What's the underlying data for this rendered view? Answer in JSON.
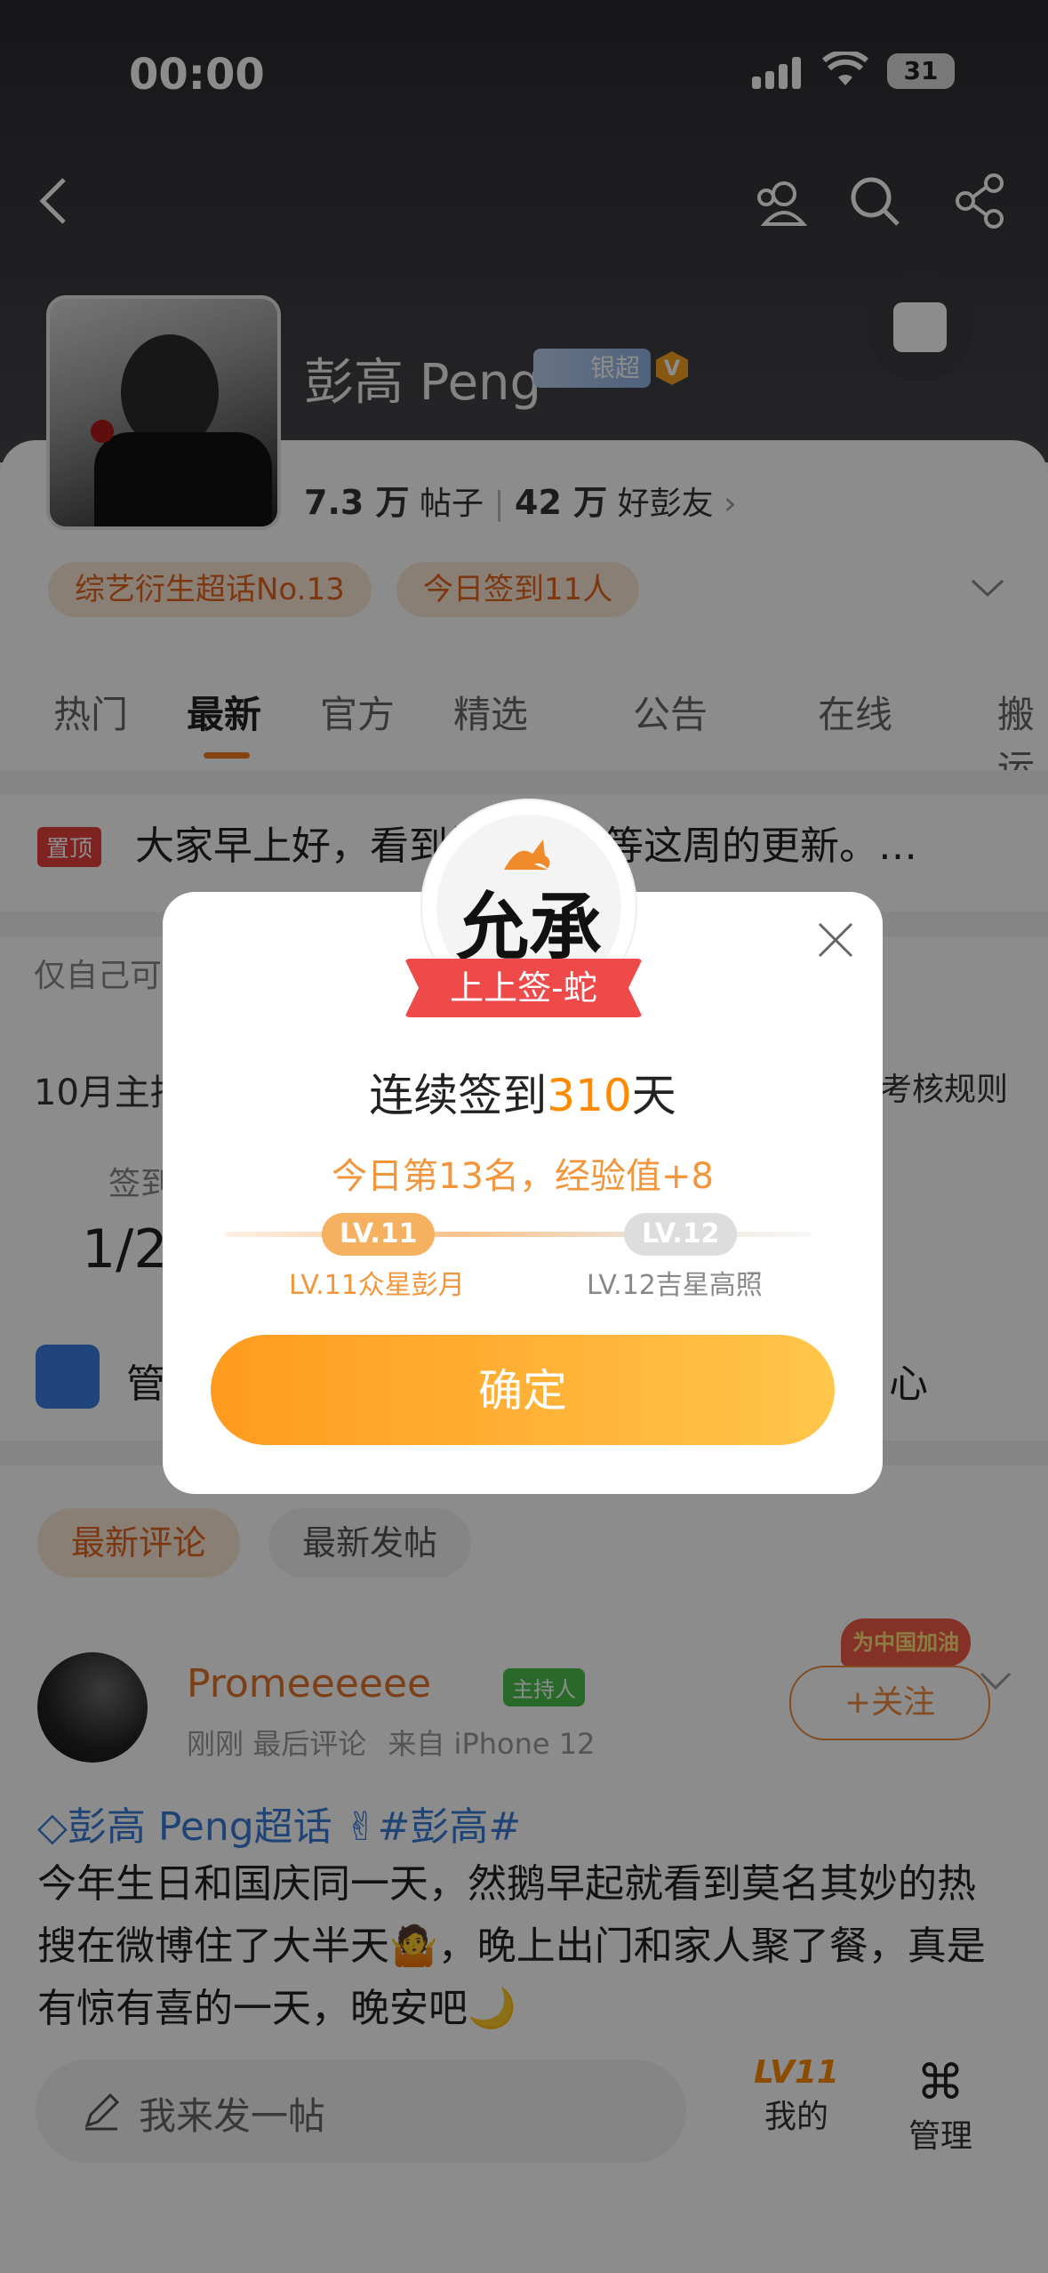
{
  "status_bar": {
    "time": "00:00",
    "battery": "31"
  },
  "profile": {
    "name": "彭高 Peng",
    "badge_level": "银超",
    "verified_mark": "V",
    "posts_count": "7.3 万",
    "posts_label": "帖子",
    "fans_count": "42 万",
    "fans_label": "好彭友",
    "fans_chevron": "›"
  },
  "chips": {
    "rank": "综艺衍生超话No.13",
    "checkin": "今日签到11人"
  },
  "tabs": [
    "热门",
    "最新",
    "官方",
    "精选",
    "公告",
    "在线",
    "搬运"
  ],
  "pinned": {
    "tag": "置顶",
    "text": "大家早上好，看到好多人在等这周的更新。…"
  },
  "rows": {
    "private_text": "仅自己可见",
    "monthly_text": "10月主持",
    "monthly_rule": "考核规则",
    "checkin_label": "签到",
    "checkin_value": "1/20",
    "manage_text": "管",
    "manage_right": "心"
  },
  "dialog": {
    "calligraphy": "允承",
    "ribbon": "上上签-蛇",
    "streak_prefix": "连续签到",
    "streak_days": "310",
    "streak_suffix": "天",
    "rank_text": "今日第13名，经验值+8",
    "current_level_pill": "LV.11",
    "next_level_pill": "LV.12",
    "current_level_name": "LV.11众星彭月",
    "next_level_name": "LV.12吉星高照",
    "confirm": "确定",
    "level_progress": 0.3
  },
  "comment_tabs": {
    "latest_comment": "最新评论",
    "latest_post": "最新发帖"
  },
  "post": {
    "author": "Promeeeeee",
    "host_badge": "主持人",
    "meta_time": "刚刚",
    "meta_last": "最后评论",
    "meta_source": "来自 iPhone 12",
    "follow": "+关注",
    "promo": "为中国加油",
    "topic": "彭高 Peng超话",
    "hashtag": "#彭高#",
    "text": "今年生日和国庆同一天，然鹅早起就看到莫名其妙的热搜在微博住了大半天🤷，晚上出门和家人聚了餐，真是有惊有喜的一天，晚安吧🌙"
  },
  "bottom": {
    "compose_placeholder": "我来发一帖",
    "mine": "我的",
    "mine_level": "LV11",
    "manage": "管理"
  },
  "colors": {
    "accent": "#ff8a00",
    "orange_text": "#e4742a",
    "topic_blue": "#3a7bd5",
    "overlay": "rgba(0,0,0,0.45)"
  }
}
